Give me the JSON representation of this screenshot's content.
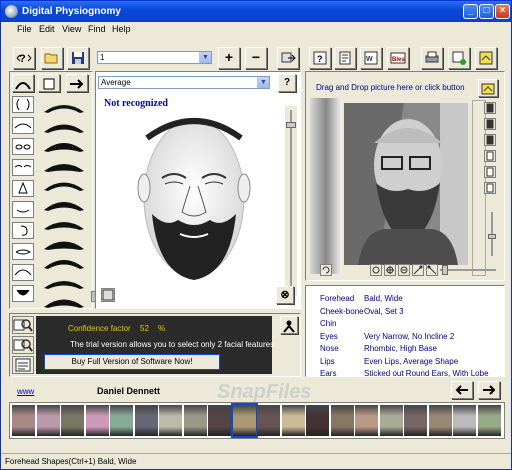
{
  "window": {
    "title": "Digital Physiognomy"
  },
  "menu": [
    "File",
    "Edit",
    "View",
    "Find",
    "Help"
  ],
  "toolbar": {
    "combo_value": "1",
    "plus": "+",
    "minus": "−"
  },
  "left_panel": {
    "template_combo": "Average",
    "status": "Not recognized"
  },
  "right_panel": {
    "drop_hint": "Drag and Drop picture here or click button"
  },
  "features": [
    {
      "name": "Forehead",
      "value": "Bald, Wide"
    },
    {
      "name": "Cheek-bone",
      "value": "Oval, Set  3"
    },
    {
      "name": "Chin",
      "value": ""
    },
    {
      "name": "Eyes",
      "value": "Very Narrow, No Incline 2"
    },
    {
      "name": "Nose",
      "value": "Rhombic, High Base"
    },
    {
      "name": "Lips",
      "value": "Even Lips, Average Shape"
    },
    {
      "name": "Ears",
      "value": "Sticked out Round Ears, With Lobe"
    }
  ],
  "bottom_panel": {
    "confidence_label": "Confidence factor",
    "confidence_value": "52",
    "confidence_unit": "%",
    "trial_text": "The trial version allows you to select only 2 facial features",
    "buy_button": "Buy Full Version of Software Now!"
  },
  "celebrity": {
    "link": "www",
    "name": "Daniel Dennett"
  },
  "statusbar": "Forehead Shapes(Ctrl+1) Bald, Wide",
  "watermark": "SnapFiles",
  "colors": {
    "title_blue": "#0a4ad8",
    "status_blue": "#0000cc",
    "confidence_yellow": "#e6c800",
    "feature_blue": "#00008b"
  }
}
